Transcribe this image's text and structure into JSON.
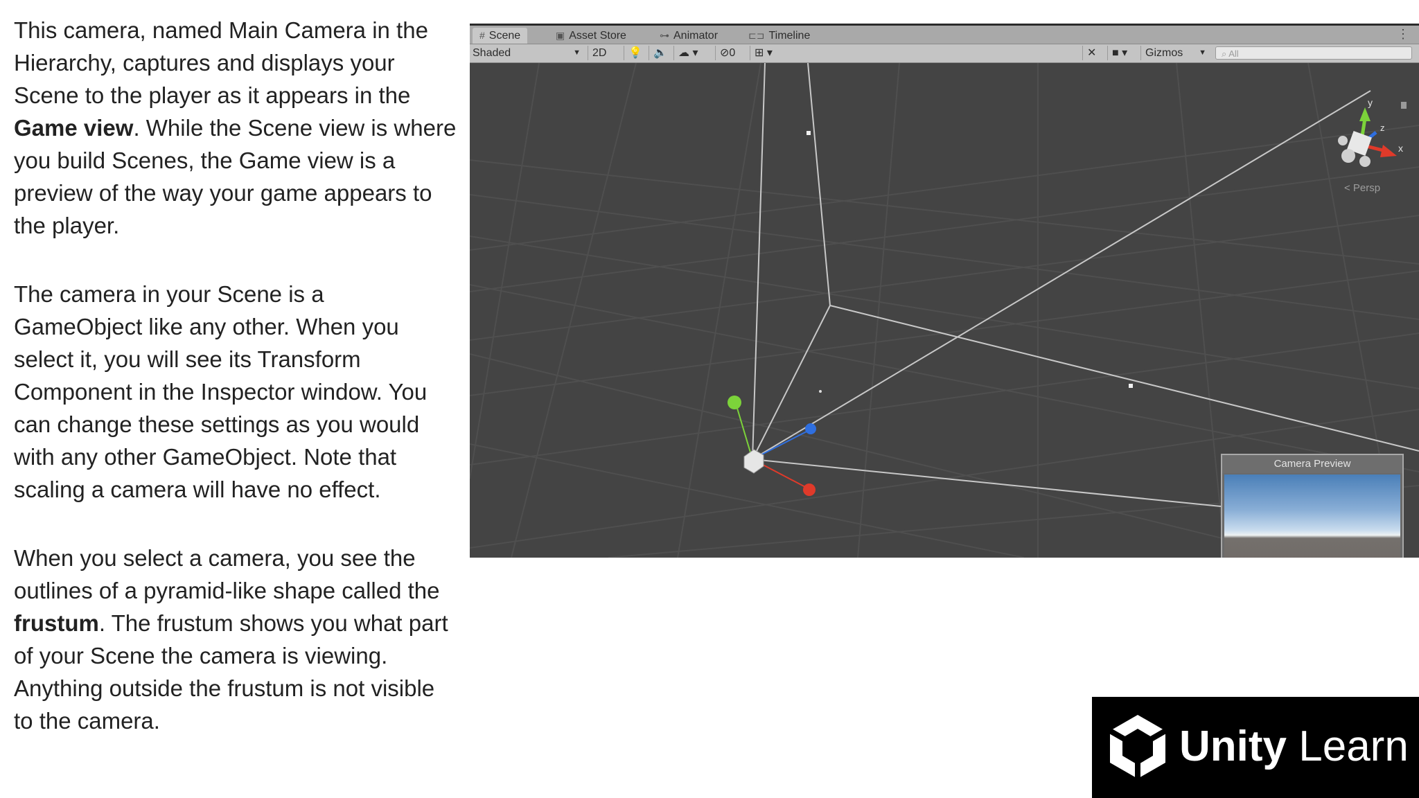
{
  "text": {
    "p1_a": "This camera, named Main Camera in the Hierarchy, captures and displays your Scene to the player as it appears in the ",
    "p1_bold": "Game view",
    "p1_b": ". While the Scene view is where you build Scenes, the Game view is a preview of the way your game appears to the player.",
    "p2": "The camera in your Scene is a GameObject like any other. When you select it, you will see its Transform Component in the Inspector window. You can change these settings as you would with any other GameObject. Note that scaling a camera will have no effect.",
    "p3_a": "When you select a camera, you see the outlines of a pyramid-like shape called the ",
    "p3_bold": "frustum",
    "p3_b": ". The frustum shows you what part of your Scene the camera is viewing. Anything outside the frustum is not visible to the camera."
  },
  "editor": {
    "tabs": [
      {
        "label": "Scene",
        "icon": "grid-icon",
        "active": true
      },
      {
        "label": "Asset Store",
        "icon": "store-icon",
        "active": false
      },
      {
        "label": "Animator",
        "icon": "animator-icon",
        "active": false
      },
      {
        "label": "Timeline",
        "icon": "timeline-icon",
        "active": false
      }
    ],
    "toolbar": {
      "draw_mode": "Shaded",
      "mode_2d": "2D",
      "hidden_count": "0",
      "gizmos": "Gizmos",
      "search_placeholder": "All"
    },
    "scene": {
      "persp_label": "< Persp",
      "axis_y": "y",
      "axis_x": "x",
      "axis_z": "z"
    },
    "camera_preview": {
      "title": "Camera Preview"
    }
  },
  "logo": {
    "bold": "Unity",
    "light": " Learn"
  },
  "colors": {
    "viewport_bg": "#444444",
    "grid_line": "#4e4e4e",
    "frustum_line": "#c8c8c8",
    "gizmo_y": "#7cd33a",
    "gizmo_x": "#e03a2a",
    "gizmo_z": "#2f6fe0"
  }
}
